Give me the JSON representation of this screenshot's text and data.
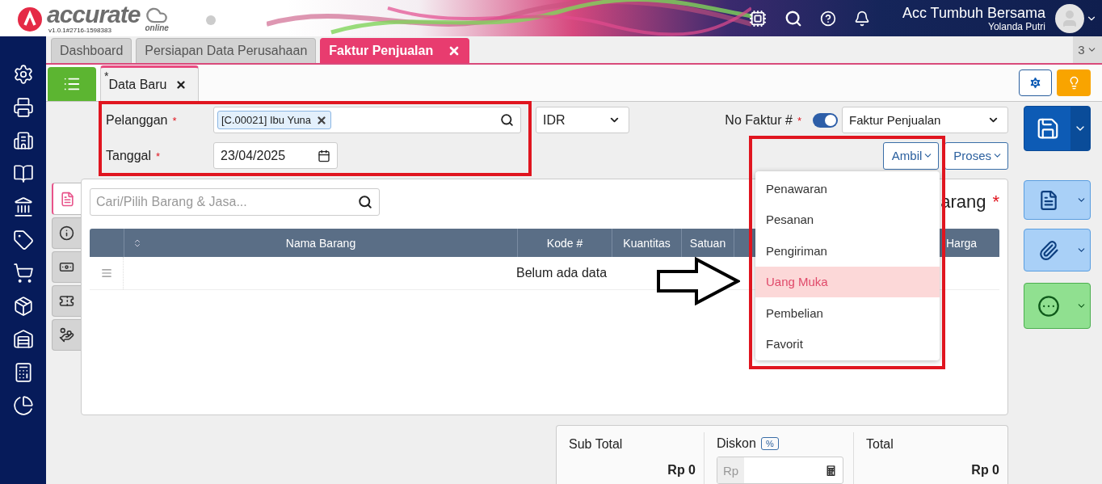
{
  "header": {
    "logo_text": "accurate",
    "logo_sub": "online",
    "version": "v1.0.1#2716-1598383",
    "company": "Acc Tumbuh Bersama",
    "user": "Yolanda Putri"
  },
  "tabs": [
    {
      "label": "Dashboard",
      "selected": false,
      "closable": false
    },
    {
      "label": "Persiapan Data Perusahaan",
      "selected": false,
      "closable": false
    },
    {
      "label": "Faktur Penjualan",
      "selected": true,
      "closable": true
    }
  ],
  "tab_count": "3",
  "subtab": {
    "marker": "*",
    "label": "Data Baru"
  },
  "form": {
    "customer": {
      "label": "Pelanggan",
      "mark": "*",
      "value": "[C.00021] Ibu Yuna"
    },
    "date": {
      "label": "Tanggal",
      "mark": "*",
      "value": "23/04/2025"
    },
    "currency": "IDR",
    "invoice_no": {
      "label": "No Faktur #",
      "mark": "*",
      "auto": true,
      "type": "Faktur Penjualan"
    }
  },
  "actions": [
    {
      "label": "Ambil"
    },
    {
      "label": "Proses"
    }
  ],
  "side_tabs": [
    {
      "selected": true
    },
    {
      "selected": false
    },
    {
      "selected": false
    },
    {
      "selected": false
    },
    {
      "selected": false
    }
  ],
  "item_search": {
    "placeholder": "Cari/Pilih Barang & Jasa..."
  },
  "section_title": {
    "text": "arang",
    "mark": "*"
  },
  "table": {
    "columns": [
      {
        "label": "Nama Barang"
      },
      {
        "label": "Kode #"
      },
      {
        "label": "Kuantitas"
      },
      {
        "label": "Satuan"
      },
      {
        "label": "Harga"
      }
    ],
    "empty_text": "Belum ada data"
  },
  "totals": {
    "subtotal": {
      "label": "Sub Total",
      "value": "Rp 0"
    },
    "discount": {
      "label": "Diskon",
      "unit": "%",
      "prefix": "Rp"
    },
    "total": {
      "label": "Total",
      "value": "Rp 0"
    }
  },
  "menu": {
    "items": [
      {
        "label": "Penawaran",
        "selected": false
      },
      {
        "label": "Pesanan",
        "selected": false
      },
      {
        "label": "Pengiriman",
        "selected": false
      },
      {
        "label": "Uang Muka",
        "selected": true
      },
      {
        "label": "Pembelian",
        "selected": false
      },
      {
        "label": "Favorit",
        "selected": false
      }
    ]
  },
  "annotations": [
    {
      "kind": "box"
    },
    {
      "kind": "box"
    },
    {
      "kind": "arrow"
    }
  ]
}
